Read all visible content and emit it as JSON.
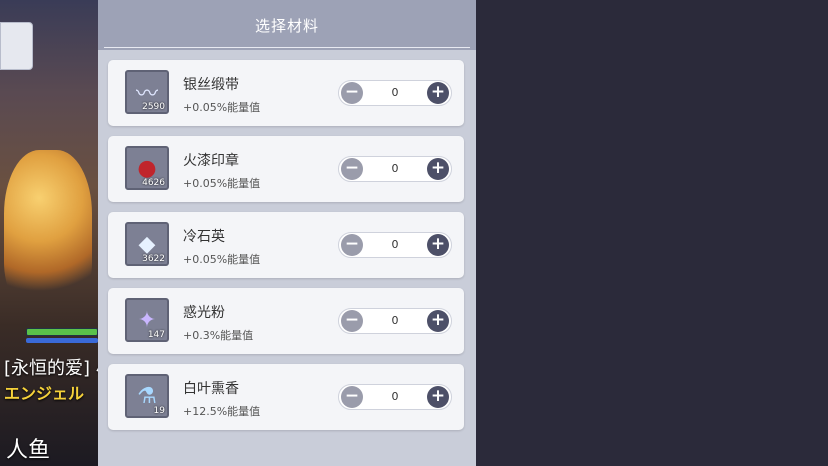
{
  "left_scene": {
    "name_line1": "[永恒的爱] 小丸风",
    "name_line2": "エンジェル",
    "name_line3": "人鱼"
  },
  "materials_panel": {
    "title": "选择材料",
    "items": [
      {
        "name": "银丝缎带",
        "effect": "+0.05%能量值",
        "count": "2590",
        "qty": "0",
        "icon": "ribbon-icon"
      },
      {
        "name": "火漆印章",
        "effect": "+0.05%能量值",
        "count": "4626",
        "qty": "0",
        "icon": "wax-seal-icon"
      },
      {
        "name": "冷石英",
        "effect": "+0.05%能量值",
        "count": "3622",
        "qty": "0",
        "icon": "quartz-icon"
      },
      {
        "name": "惑光粉",
        "effect": "+0.3%能量值",
        "count": "147",
        "qty": "0",
        "icon": "glitter-dust-icon"
      },
      {
        "name": "白叶熏香",
        "effect": "+12.5%能量值",
        "count": "19",
        "qty": "0",
        "icon": "incense-vial-icon"
      }
    ]
  }
}
